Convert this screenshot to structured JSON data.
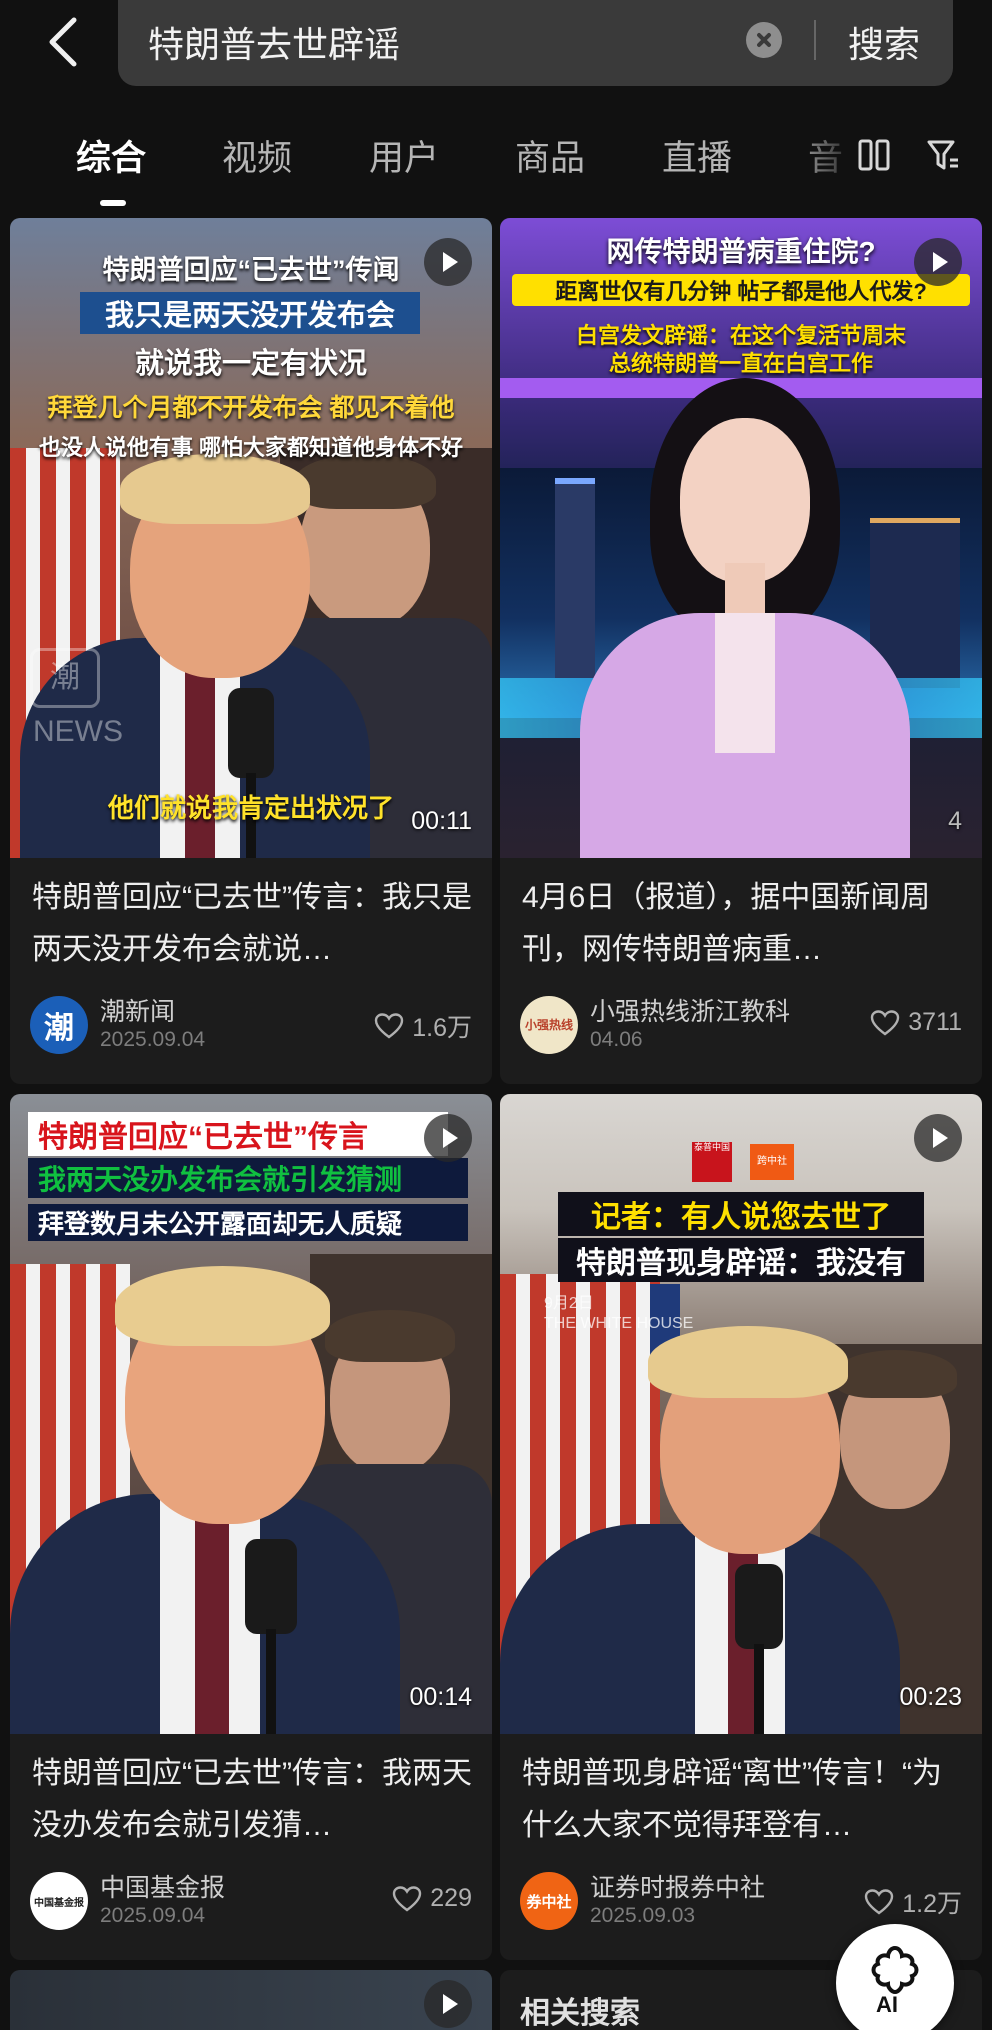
{
  "search": {
    "query": "特朗普去世辟谣",
    "button": "搜索"
  },
  "tabs": [
    "综合",
    "视频",
    "用户",
    "商品",
    "直播",
    "音"
  ],
  "cards": [
    {
      "captions": [
        "特朗普回应“已去世”传闻",
        "我只是两天没开发布会",
        "就说我一定有状况",
        "拜登几个月都不开发布会 都见不着他",
        "也没人说他有事 哪怕大家都知道他身体不好",
        "他们就说我肯定出状况了"
      ],
      "watermark": "潮 NEWS",
      "duration": "00:11",
      "title": "特朗普回应“已去世”传言：我只是两天没开发布会就说…",
      "author": "潮新闻",
      "avatar_text": "潮",
      "date": "2025.09.04",
      "likes": "1.6万"
    },
    {
      "captions": [
        "网传特朗普病重住院?",
        "距离世仅有几分钟 帖子都是他人代发?",
        "白宫发文辟谣：在这个复活节周末",
        "总统特朗普一直在白宫工作"
      ],
      "duration": "4",
      "title": "4月6日（报道），据中国新闻周刊，网传特朗普病重…",
      "author": "小强热线浙江教科",
      "avatar_text": "小强热线",
      "date": "04.06",
      "likes": "3711"
    },
    {
      "captions": [
        "特朗普回应“已去世”传言",
        "我两天没办发布会就引发猜测",
        "拜登数月未公开露面却无人质疑"
      ],
      "duration": "00:14",
      "title": "特朗普回应“已去世”传言：我两天没办发布会就引发猜…",
      "author": "中国基金报",
      "avatar_text": "中国基金报",
      "date": "2025.09.04",
      "likes": "229"
    },
    {
      "captions": [
        "记者：有人说您去世了",
        "特朗普现身辟谣：我没有"
      ],
      "logos": [
        "泰普中国",
        "跨中社"
      ],
      "overlay": [
        "9月2日",
        "THE WHITE HOUSE"
      ],
      "duration": "00:23",
      "title": "特朗普现身辟谣“离世”传言！“为什么大家不觉得拜登有…",
      "author": "证券时报券中社",
      "avatar_text": "券中社",
      "date": "2025.09.03",
      "likes": "1.2万"
    }
  ],
  "related_search": "相关搜索",
  "ai_button": "AI"
}
